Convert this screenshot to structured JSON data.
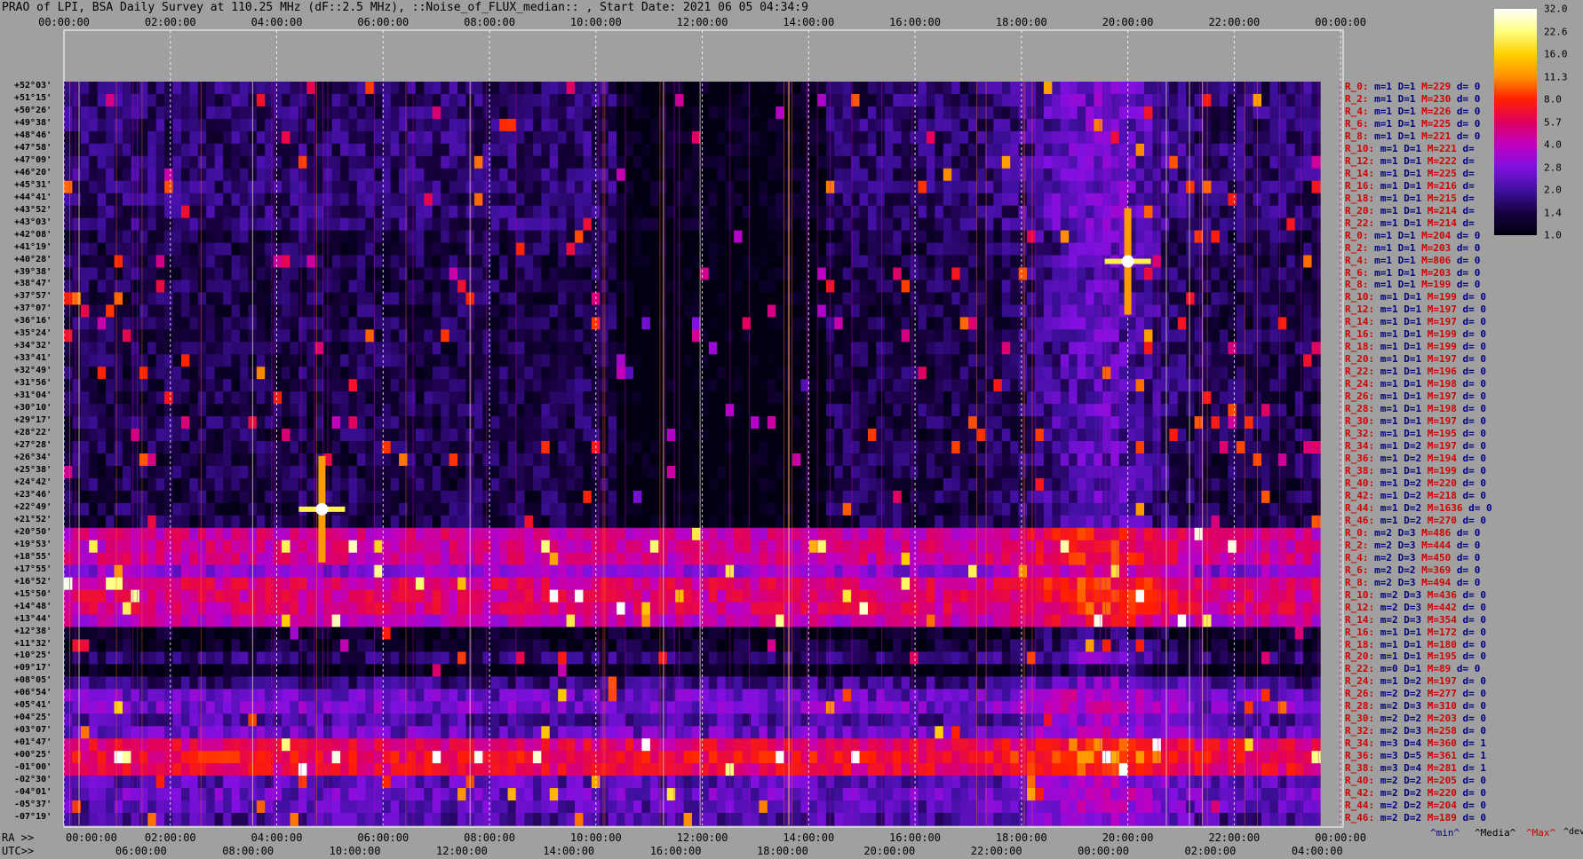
{
  "title": "PRAO of LPI, BSA Daily Survey at 110.25 MHz (dF::2.5 MHz), ::Noise_of_FLUX_median:: , Start Date: 2021 06 05 04:34:9",
  "top_axis": [
    "00:00:00",
    "02:00:00",
    "04:00:00",
    "06:00:00",
    "08:00:00",
    "10:00:00",
    "12:00:00",
    "14:00:00",
    "16:00:00",
    "18:00:00",
    "20:00:00",
    "22:00:00",
    "00:00:00"
  ],
  "bottom_axis": {
    "ra_prefix": "RA >>",
    "ra_ticks": [
      "00:00:00",
      "02:00:00",
      "04:00:00",
      "06:00:00",
      "08:00:00",
      "10:00:00",
      "12:00:00",
      "14:00:00",
      "16:00:00",
      "18:00:00",
      "20:00:00",
      "22:00:00",
      "00:00:00"
    ],
    "utc_prefix": "UTC>>",
    "utc_ticks": [
      "06:00:00",
      "08:00:00",
      "10:00:00",
      "12:00:00",
      "14:00:00",
      "16:00:00",
      "18:00:00",
      "20:00:00",
      "22:00:00",
      "00:00:00",
      "02:00:00",
      "04:00:00"
    ]
  },
  "colorbar": {
    "labels": [
      "32.0",
      "22.6",
      "16.0",
      "11.3",
      "8.0",
      "5.7",
      "4.0",
      "2.8",
      "2.0",
      "1.4",
      "1.0"
    ],
    "stops": [
      "#ffffff",
      "#ffff80",
      "#ffd000",
      "#ff9000",
      "#ff2000",
      "#e00060",
      "#c000c0",
      "#8010e0",
      "#4010a0",
      "#180040",
      "#000010"
    ]
  },
  "footer": {
    "min": "^min^",
    "median": "^Media^",
    "max": "^Max^",
    "devia": "^devia^"
  },
  "chart_data": {
    "type": "heatmap",
    "xlabel": "",
    "ylabel": "",
    "declinations": [
      "+52°03'",
      "+51°15'",
      "+50°26'",
      "+49°38'",
      "+48°46'",
      "+47°58'",
      "+47°09'",
      "+46°20'",
      "+45°31'",
      "+44°41'",
      "+43°52'",
      "+43°03'",
      "+42°08'",
      "+41°19'",
      "+40°28'",
      "+39°38'",
      "+38°47'",
      "+37°57'",
      "+37°07'",
      "+36°16'",
      "+35°24'",
      "+34°32'",
      "+33°41'",
      "+32°49'",
      "+31°56'",
      "+31°04'",
      "+30°10'",
      "+29°17'",
      "+28°22'",
      "+27°28'",
      "+26°34'",
      "+25°38'",
      "+24°42'",
      "+23°46'",
      "+22°49'",
      "+21°52'",
      "+20°50'",
      "+19°53'",
      "+18°55'",
      "+17°55'",
      "+16°52'",
      "+15°50'",
      "+14°48'",
      "+13°44'",
      "+12°38'",
      "+11°32'",
      "+10°25'",
      "+09°17'",
      "+08°05'",
      "+06°54'",
      "+05°41'",
      "+04°25'",
      "+03°07'",
      "+01°47'",
      "+00°25'",
      "-01°00'",
      "-02°30'",
      "-04°01'",
      "-05°37'",
      "-07°19'"
    ],
    "row_stats": [
      {
        "r": "R_0:",
        "m": "m=1",
        "d": "D=1",
        "M": "M=229",
        "dev": "d= 0"
      },
      {
        "r": "R_2:",
        "m": "m=1",
        "d": "D=1",
        "M": "M=230",
        "dev": "d= 0"
      },
      {
        "r": "R_4:",
        "m": "m=1",
        "d": "D=1",
        "M": "M=226",
        "dev": "d= 0"
      },
      {
        "r": "R_6:",
        "m": "m=1",
        "d": "D=1",
        "M": "M=225",
        "dev": "d= 0"
      },
      {
        "r": "R_8:",
        "m": "m=1",
        "d": "D=1",
        "M": "M=221",
        "dev": "d= 0"
      },
      {
        "r": "R_10:",
        "m": "m=1",
        "d": "D=1",
        "M": "M=221",
        "dev": "d="
      },
      {
        "r": "R_12:",
        "m": "m=1",
        "d": "D=1",
        "M": "M=222",
        "dev": "d="
      },
      {
        "r": "R_14:",
        "m": "m=1",
        "d": "D=1",
        "M": "M=225",
        "dev": "d="
      },
      {
        "r": "R_16:",
        "m": "m=1",
        "d": "D=1",
        "M": "M=216",
        "dev": "d="
      },
      {
        "r": "R_18:",
        "m": "m=1",
        "d": "D=1",
        "M": "M=215",
        "dev": "d="
      },
      {
        "r": "R_20:",
        "m": "m=1",
        "d": "D=1",
        "M": "M=214",
        "dev": "d="
      },
      {
        "r": "R_22:",
        "m": "m=1",
        "d": "D=1",
        "M": "M=214",
        "dev": "d="
      },
      {
        "r": "R_0:",
        "m": "m=1",
        "d": "D=1",
        "M": "M=204",
        "dev": "d= 0"
      },
      {
        "r": "R_2:",
        "m": "m=1",
        "d": "D=1",
        "M": "M=203",
        "dev": "d= 0"
      },
      {
        "r": "R_4:",
        "m": "m=1",
        "d": "D=1",
        "M": "M=806",
        "dev": "d= 0"
      },
      {
        "r": "R_6:",
        "m": "m=1",
        "d": "D=1",
        "M": "M=203",
        "dev": "d= 0"
      },
      {
        "r": "R_8:",
        "m": "m=1",
        "d": "D=1",
        "M": "M=199",
        "dev": "d= 0"
      },
      {
        "r": "R_10:",
        "m": "m=1",
        "d": "D=1",
        "M": "M=199",
        "dev": "d= 0"
      },
      {
        "r": "R_12:",
        "m": "m=1",
        "d": "D=1",
        "M": "M=197",
        "dev": "d= 0"
      },
      {
        "r": "R_14:",
        "m": "m=1",
        "d": "D=1",
        "M": "M=197",
        "dev": "d= 0"
      },
      {
        "r": "R_16:",
        "m": "m=1",
        "d": "D=1",
        "M": "M=199",
        "dev": "d= 0"
      },
      {
        "r": "R_18:",
        "m": "m=1",
        "d": "D=1",
        "M": "M=199",
        "dev": "d= 0"
      },
      {
        "r": "R_20:",
        "m": "m=1",
        "d": "D=1",
        "M": "M=197",
        "dev": "d= 0"
      },
      {
        "r": "R_22:",
        "m": "m=1",
        "d": "D=1",
        "M": "M=196",
        "dev": "d= 0"
      },
      {
        "r": "R_24:",
        "m": "m=1",
        "d": "D=1",
        "M": "M=198",
        "dev": "d= 0"
      },
      {
        "r": "R_26:",
        "m": "m=1",
        "d": "D=1",
        "M": "M=197",
        "dev": "d= 0"
      },
      {
        "r": "R_28:",
        "m": "m=1",
        "d": "D=1",
        "M": "M=198",
        "dev": "d= 0"
      },
      {
        "r": "R_30:",
        "m": "m=1",
        "d": "D=1",
        "M": "M=197",
        "dev": "d= 0"
      },
      {
        "r": "R_32:",
        "m": "m=1",
        "d": "D=1",
        "M": "M=195",
        "dev": "d= 0"
      },
      {
        "r": "R_34:",
        "m": "m=1",
        "d": "D=2",
        "M": "M=197",
        "dev": "d= 0"
      },
      {
        "r": "R_36:",
        "m": "m=1",
        "d": "D=2",
        "M": "M=194",
        "dev": "d= 0"
      },
      {
        "r": "R_38:",
        "m": "m=1",
        "d": "D=1",
        "M": "M=199",
        "dev": "d= 0"
      },
      {
        "r": "R_40:",
        "m": "m=1",
        "d": "D=2",
        "M": "M=220",
        "dev": "d= 0"
      },
      {
        "r": "R_42:",
        "m": "m=1",
        "d": "D=2",
        "M": "M=218",
        "dev": "d= 0"
      },
      {
        "r": "R_44:",
        "m": "m=1",
        "d": "D=2",
        "M": "M=1636",
        "dev": "d= 0"
      },
      {
        "r": "R_46:",
        "m": "m=1",
        "d": "D=2",
        "M": "M=270",
        "dev": "d= 0"
      },
      {
        "r": "R_0:",
        "m": "m=2",
        "d": "D=3",
        "M": "M=486",
        "dev": "d= 0"
      },
      {
        "r": "R_2:",
        "m": "m=2",
        "d": "D=3",
        "M": "M=444",
        "dev": "d= 0"
      },
      {
        "r": "R_4:",
        "m": "m=2",
        "d": "D=3",
        "M": "M=450",
        "dev": "d= 0"
      },
      {
        "r": "R_6:",
        "m": "m=2",
        "d": "D=2",
        "M": "M=369",
        "dev": "d= 0"
      },
      {
        "r": "R_8:",
        "m": "m=2",
        "d": "D=3",
        "M": "M=494",
        "dev": "d= 0"
      },
      {
        "r": "R_10:",
        "m": "m=2",
        "d": "D=3",
        "M": "M=436",
        "dev": "d= 0"
      },
      {
        "r": "R_12:",
        "m": "m=2",
        "d": "D=3",
        "M": "M=442",
        "dev": "d= 0"
      },
      {
        "r": "R_14:",
        "m": "m=2",
        "d": "D=3",
        "M": "M=354",
        "dev": "d= 0"
      },
      {
        "r": "R_16:",
        "m": "m=1",
        "d": "D=1",
        "M": "M=172",
        "dev": "d= 0"
      },
      {
        "r": "R_18:",
        "m": "m=1",
        "d": "D=1",
        "M": "M=180",
        "dev": "d= 0"
      },
      {
        "r": "R_20:",
        "m": "m=1",
        "d": "D=1",
        "M": "M=195",
        "dev": "d= 0"
      },
      {
        "r": "R_22:",
        "m": "m=0",
        "d": "D=1",
        "M": "M=89",
        "dev": "d= 0"
      },
      {
        "r": "R_24:",
        "m": "m=1",
        "d": "D=2",
        "M": "M=197",
        "dev": "d= 0"
      },
      {
        "r": "R_26:",
        "m": "m=2",
        "d": "D=2",
        "M": "M=277",
        "dev": "d= 0"
      },
      {
        "r": "R_28:",
        "m": "m=2",
        "d": "D=3",
        "M": "M=310",
        "dev": "d= 0"
      },
      {
        "r": "R_30:",
        "m": "m=2",
        "d": "D=2",
        "M": "M=203",
        "dev": "d= 0"
      },
      {
        "r": "R_32:",
        "m": "m=2",
        "d": "D=3",
        "M": "M=258",
        "dev": "d= 0"
      },
      {
        "r": "R_34:",
        "m": "m=3",
        "d": "D=4",
        "M": "M=360",
        "dev": "d= 1"
      },
      {
        "r": "R_36:",
        "m": "m=3",
        "d": "D=5",
        "M": "M=361",
        "dev": "d= 1"
      },
      {
        "r": "R_38:",
        "m": "m=3",
        "d": "D=4",
        "M": "M=281",
        "dev": "d= 1"
      },
      {
        "r": "R_40:",
        "m": "m=2",
        "d": "D=2",
        "M": "M=205",
        "dev": "d= 0"
      },
      {
        "r": "R_42:",
        "m": "m=2",
        "d": "D=2",
        "M": "M=220",
        "dev": "d= 0"
      },
      {
        "r": "R_44:",
        "m": "m=2",
        "d": "D=2",
        "M": "M=204",
        "dev": "d= 0"
      },
      {
        "r": "R_46:",
        "m": "m=2",
        "d": "D=2",
        "M": "M=189",
        "dev": "d= 0"
      }
    ],
    "band_levels": [
      1.6,
      1.6,
      1.6,
      1.6,
      1.6,
      1.6,
      1.6,
      1.6,
      1.6,
      1.6,
      1.6,
      1.6,
      1.4,
      1.4,
      1.4,
      1.4,
      1.4,
      1.4,
      1.4,
      1.4,
      1.4,
      1.4,
      1.4,
      1.4,
      1.4,
      1.4,
      1.4,
      1.4,
      1.4,
      1.4,
      1.4,
      1.4,
      1.4,
      1.4,
      1.4,
      1.4,
      4.5,
      4.5,
      4.5,
      3.0,
      5.0,
      5.0,
      5.0,
      4.0,
      1.1,
      1.2,
      1.6,
      1.0,
      1.8,
      2.4,
      2.6,
      2.0,
      2.4,
      5.5,
      6.5,
      5.8,
      2.2,
      2.4,
      2.2,
      2.0
    ],
    "sources": [
      {
        "name": "",
        "ra_hours": 4.85,
        "dec": "+22°49'",
        "peak": 32.0
      },
      {
        "name": "",
        "ra_hours": 20.0,
        "dec": "+40°28'",
        "peak": 32.0
      }
    ],
    "zlim": [
      1.0,
      32.0
    ]
  }
}
